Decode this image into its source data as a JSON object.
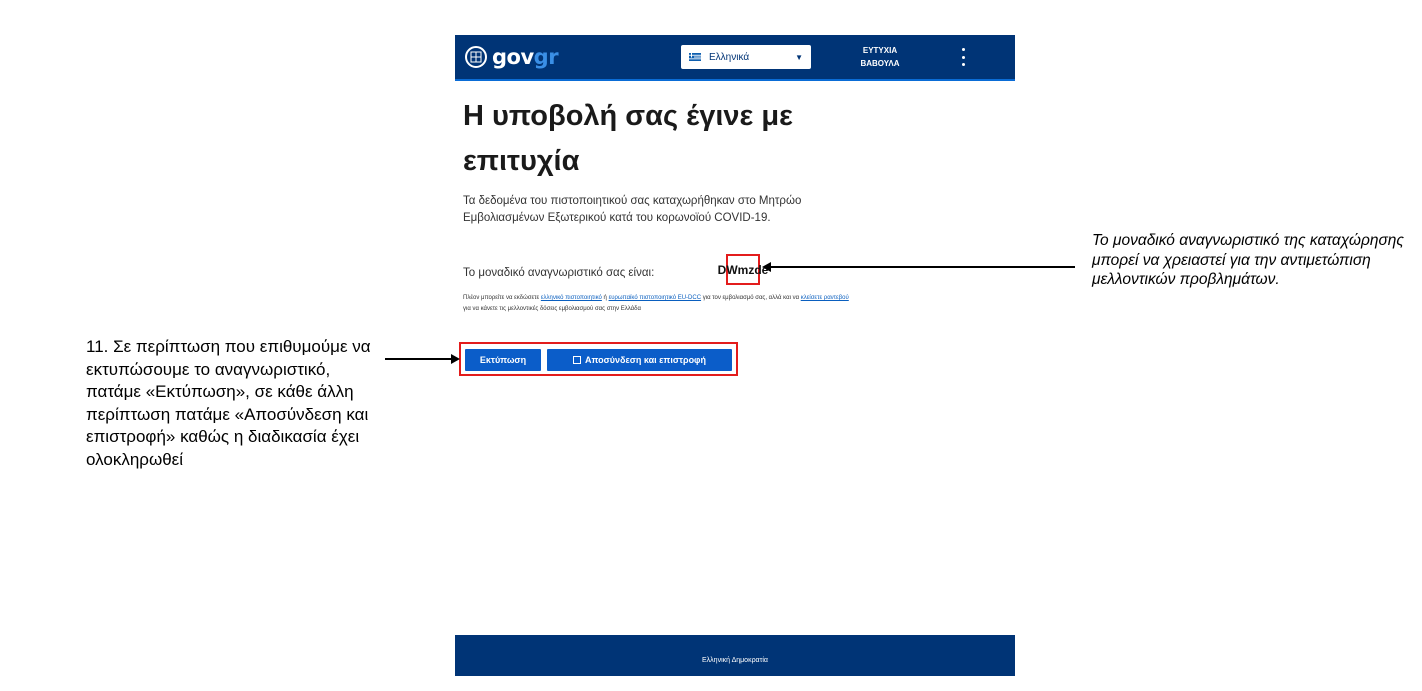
{
  "header": {
    "logo_text_gov": "gov",
    "logo_text_gr": "gr",
    "language": "Ελληνικά",
    "user_line1": "ΕΥΤΥΧΙΑ",
    "user_line2": "ΒΑΒΟΥΛΑ"
  },
  "main": {
    "title": "Η υποβολή σας έγινε με επιτυχία",
    "paragraph": "Τα δεδομένα του πιστοποιητικού σας καταχωρήθηκαν στο Μητρώο Εμβολιασμένων Εξωτερικού κατά του κορωνοϊού COVID-19.",
    "identifier_label": "Το μοναδικό αναγνωριστικό σας είναι:",
    "identifier_value": "DWmzde",
    "fine": {
      "part1": "Πλέον μπορείτε να εκδώσετε ",
      "link1": "ελληνικό πιστοποιητικό",
      "part2": " ή ",
      "link2": "ευρωπαϊκό πιστοποιητικό EU-DCC",
      "part3": " για τον εμβολιασμό σας, αλλά και να ",
      "link3": "κλείσετε ραντεβού",
      "part4": " για να κάνετε τις μελλοντικές δόσεις εμβολιασμού σας στην Ελλάδα"
    },
    "print_button": "Εκτύπωση",
    "logout_button": "Αποσύνδεση και επιστροφή"
  },
  "annotations": {
    "right": "Το μοναδικό αναγνωριστικό της καταχώρησης μπορεί να χρειαστεί για την αντιμετώπιση μελλοντικών προβλημάτων.",
    "left": "11. Σε περίπτωση που επιθυμούμε να εκτυπώσουμε το αναγνωριστικό, πατάμε «Εκτύπωση», σε κάθε άλλη περίπτωση πατάμε «Αποσύνδεση και επιστροφή» καθώς η διαδικασία έχει ολοκληρωθεί"
  },
  "footer": {
    "text": "Ελληνική Δημοκρατία"
  },
  "colors": {
    "header_bg": "#003476",
    "button_bg": "#0b5dc9",
    "highlight_border": "#e31c1c",
    "link": "#0a5fbf"
  },
  "icons": {
    "logo": "greek-emblem-icon",
    "flag": "greek-flag-icon",
    "dropdown": "chevron-down-icon",
    "menu": "kebab-menu-icon",
    "logout": "logout-icon"
  }
}
